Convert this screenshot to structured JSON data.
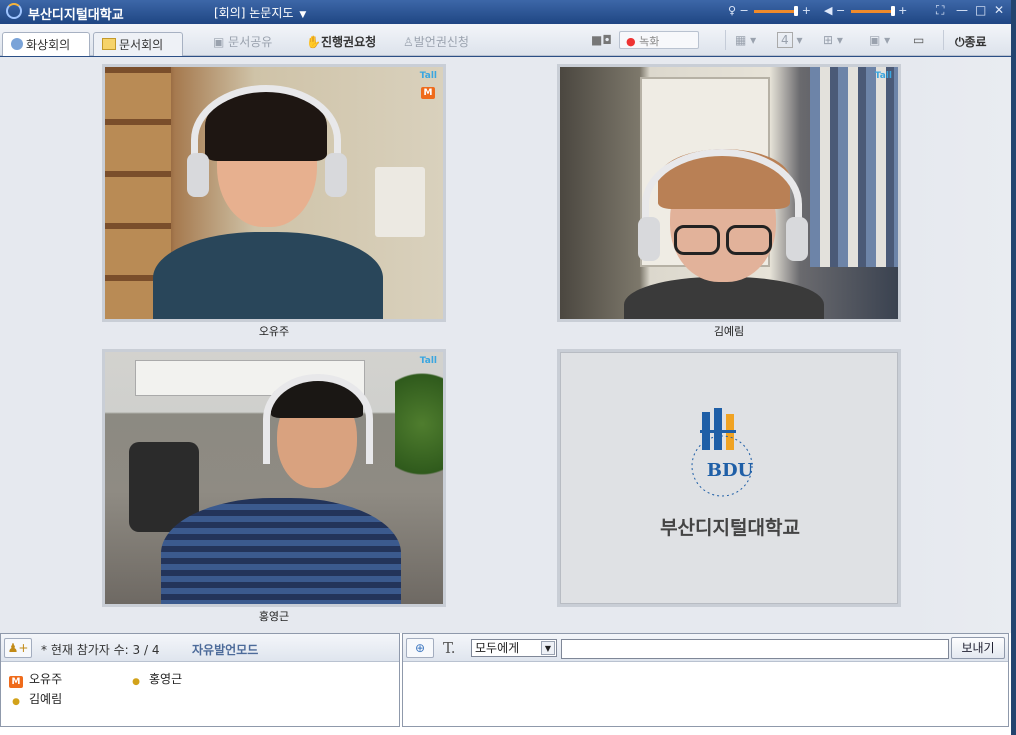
{
  "window": {
    "app_title": "부산디지털대학교",
    "meeting_title": "[회의] 논문지도"
  },
  "toolbar": {
    "tab_video": "화상회의",
    "tab_document": "문서회의",
    "doc_share": "문서공유",
    "request_control": "진행권요청",
    "request_speak": "발언권신청",
    "record": "녹화",
    "layout_count": "4",
    "exit": "종료"
  },
  "participants": [
    {
      "name": "오유주",
      "role": "moderator"
    },
    {
      "name": "김예림",
      "role": "user"
    },
    {
      "name": "홍영근",
      "role": "user"
    }
  ],
  "videos": [
    {
      "caption": "오유주",
      "signal": "Tall",
      "moderator_badge": "M"
    },
    {
      "caption": "김예림",
      "signal": "Tall"
    },
    {
      "caption": "홍영근",
      "signal": "Tall"
    },
    {
      "caption": "",
      "logo_text": "BDU",
      "logo_caption": "부산디지털대학교"
    }
  ],
  "status": {
    "count_label": "* 현재 참가자 수: 3 / 4",
    "mode": "자유발언모드"
  },
  "chat": {
    "recipient": "모두에게",
    "input_value": "",
    "send": "보내기"
  },
  "colors": {
    "titlebar": "#1f4683",
    "accent_orange": "#ef6b1b",
    "mode_text": "#4d6b9a"
  }
}
